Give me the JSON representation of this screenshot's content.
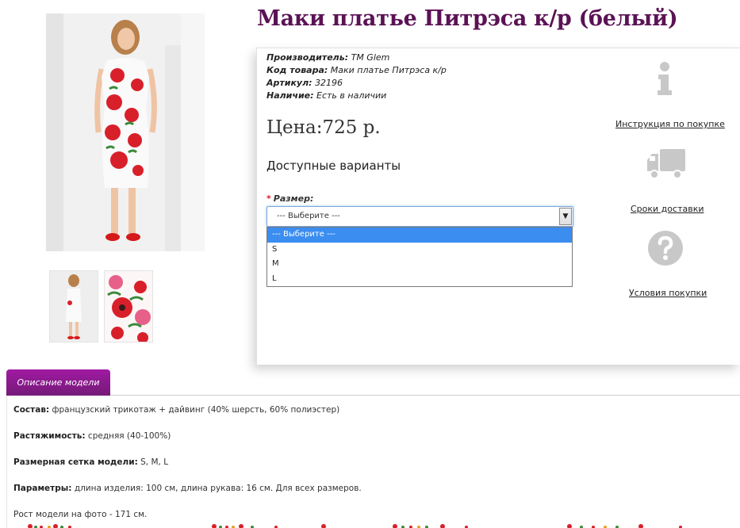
{
  "product": {
    "title": "Маки платье Питрэса к/р (белый)",
    "manufacturer_label": "Производитель:",
    "manufacturer_value": "TM Glem",
    "code_label": "Код товара:",
    "code_value": "Маки платье Питрэса к/р",
    "article_label": "Артикул:",
    "article_value": "32196",
    "availability_label": "Наличие:",
    "availability_value": "Есть в наличии",
    "price": "Цена:725 р.",
    "variants_title": "Доступные варианты"
  },
  "size_select": {
    "required_mark": "*",
    "label": "Размер:",
    "selected": "--- Выберите ---",
    "options": [
      "--- Выберите ---",
      "S",
      "M",
      "L"
    ]
  },
  "side_links": {
    "instructions": "Инструкция по покупке",
    "delivery": "Сроки доставки",
    "conditions": "Условия покупки"
  },
  "tabs": {
    "description": "Описание модели"
  },
  "description": {
    "composition_label": "Состав:",
    "composition_value": " французский трикотаж + дайвинг  (40% шерсть, 60% полиэстер)",
    "stretch_label": "Растяжимость:",
    "stretch_value": " средняя (40-100%)",
    "sizes_label": "Размерная сетка модели:",
    "sizes_value": " S, M, L",
    "params_label": "Параметры:",
    "params_value": " длина изделия: 100 см, длина рукава: 16 см. Для всех размеров.",
    "model_height": "Рост модели на фото - 171 см."
  },
  "colors": {
    "title": "#5b1255",
    "tab_top": "#a11aa2",
    "tab_bottom": "#741a78",
    "selected_option": "#3b8df0",
    "icon_gray": "#c8c8c8"
  }
}
